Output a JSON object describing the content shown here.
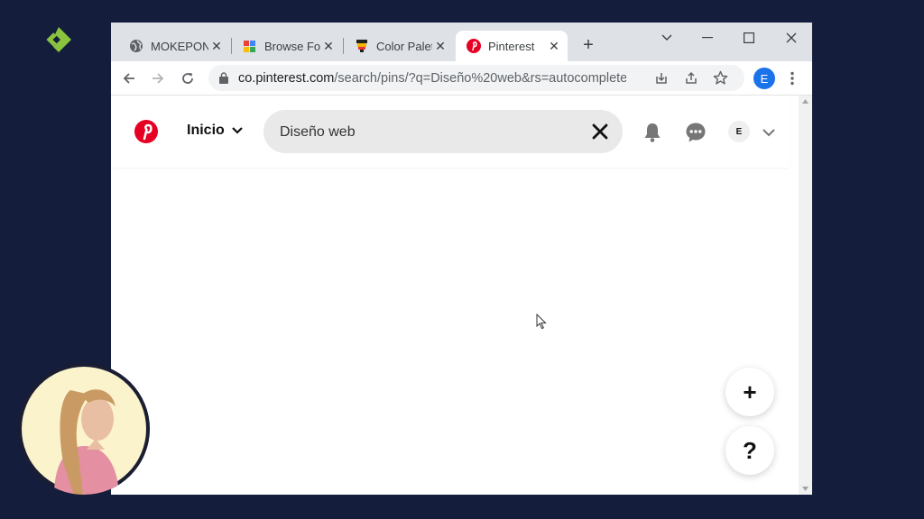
{
  "tabs": [
    {
      "title": "MOKEPON",
      "icon": "globe-icon"
    },
    {
      "title": "Browse Fo",
      "icon": "fonts-favicon-icon"
    },
    {
      "title": "Color Palet",
      "icon": "color-palette-favicon-icon"
    },
    {
      "title": "Pinterest",
      "icon": "pinterest-favicon-icon",
      "active": true
    }
  ],
  "address_bar": {
    "host": "co.pinterest.com",
    "path": "/search/pins/?q=Diseño%20web&rs=autocomplete_bu..."
  },
  "profile_initial": "E",
  "pinterest": {
    "home_label": "Inicio",
    "search_value": "Diseño web",
    "avatar_initial": "E"
  },
  "fab": {
    "create_label": "+",
    "help_label": "?"
  },
  "colors": {
    "background": "#141d3b",
    "pinterest_red": "#e60023",
    "chrome_blue": "#1a73e8",
    "brand_green": "#8ac43f"
  }
}
